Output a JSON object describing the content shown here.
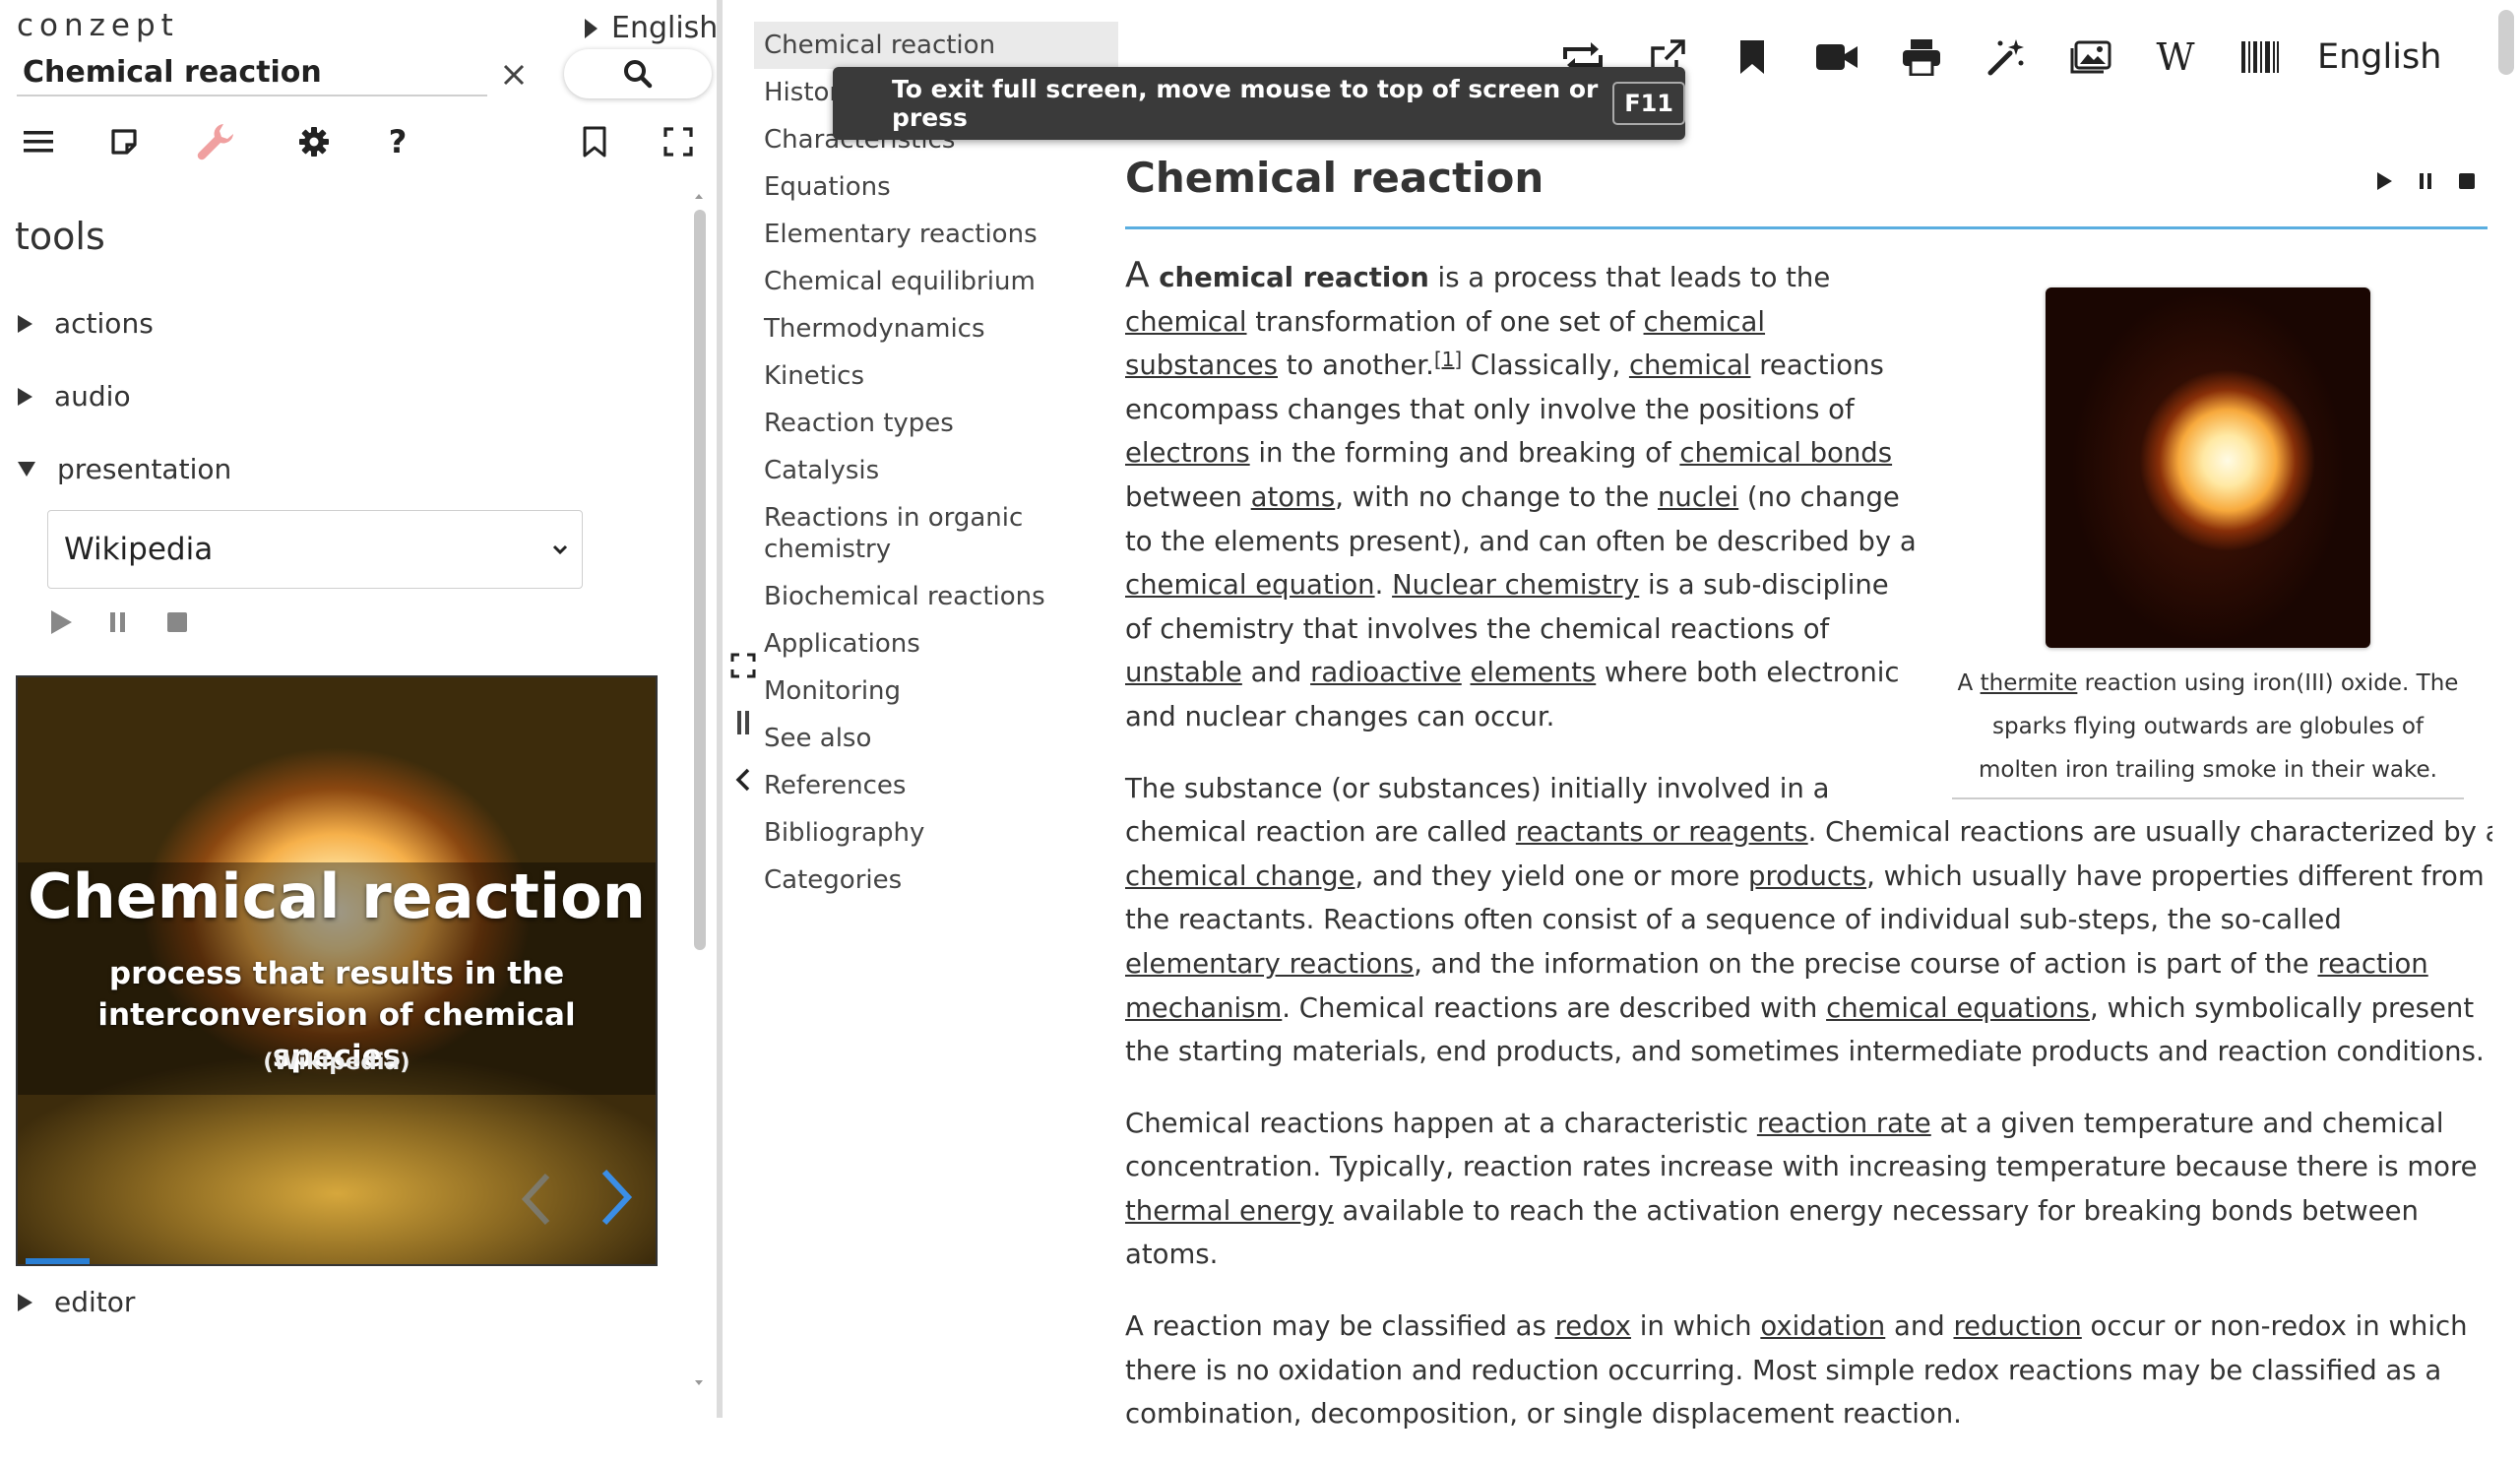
{
  "sidebar": {
    "brand": "conzept",
    "language": "English",
    "search": {
      "value": "Chemical reaction",
      "placeholder": ""
    },
    "tools_heading": "tools",
    "sections": {
      "actions": "actions",
      "audio": "audio",
      "presentation": "presentation",
      "editor": "editor"
    },
    "presentation_select": {
      "selected": "Wikipedia"
    },
    "slide": {
      "title": "Chemical reaction",
      "description": "process that results in the interconversion of chemical species",
      "source": "(Wikipedia)",
      "progress_fraction": 0.1
    }
  },
  "toc": {
    "items": [
      "Chemical reaction",
      "History",
      "Characteristics",
      "Equations",
      "Elementary reactions",
      "Chemical equilibrium",
      "Thermodynamics",
      "Kinetics",
      "Reaction types",
      "Catalysis",
      "Reactions in organic chemistry",
      "Biochemical reactions",
      "Applications",
      "Monitoring",
      "See also",
      "References",
      "Bibliography",
      "Categories"
    ]
  },
  "topbar": {
    "icons": [
      "swap-icon",
      "open-external-icon",
      "bookmark-icon",
      "video-icon",
      "print-icon",
      "magic-wand-icon",
      "images-icon",
      "wikipedia-icon",
      "barcode-icon"
    ],
    "language": "English"
  },
  "fullscreen_notice": {
    "text": "To exit full screen, move mouse to top of screen or press",
    "key": "F11"
  },
  "article": {
    "title": "Chemical reaction",
    "figure_caption_parts": [
      "A ",
      "thermite",
      " reaction using iron(III) oxide. The sparks flying outwards are globules of molten iron trailing smoke in their wake."
    ],
    "p1": [
      "A",
      " chemical reaction",
      " is a process that leads to the ",
      "chemical",
      " transformation of one set of ",
      "chemical substances",
      " to another.",
      "[1]",
      " Classically, ",
      "chemical",
      " reactions encompass changes that only involve the positions of ",
      "electrons",
      " in the forming and breaking of ",
      "chemical bonds",
      " between ",
      "atoms",
      ", with no change to the ",
      "nuclei",
      " (no change to the elements present), and can often be described by a ",
      "chemical equation",
      ". ",
      "Nuclear chemistry",
      " is a sub-discipline of chemistry that involves the chemical reactions of ",
      "unstable",
      " and ",
      "radioactive",
      " ",
      "elements",
      " where both electronic and nuclear changes can occur."
    ],
    "p2": [
      "The substance (or substances) initially involved in a chemical reaction are called ",
      "reactants or reagents",
      ". Chemical reactions are usually characterized by a ",
      "chemical change",
      ", and they yield one or more ",
      "products",
      ", which usually have properties different from the reactants. Reactions often consist of a sequence of individual sub-steps, the so-called ",
      "elementary reactions",
      ", and the information on the precise course of action is part of the ",
      "reaction mechanism",
      ". Chemical reactions are described with ",
      "chemical equations",
      ", which symbolically present the starting materials, end products, and sometimes intermediate products and reaction conditions."
    ],
    "p3": [
      "Chemical reactions happen at a characteristic ",
      "reaction rate",
      " at a given temperature and chemical concentration. Typically, reaction rates increase with increasing temperature because there is more ",
      "thermal energy",
      " available to reach the activation energy necessary for breaking bonds between atoms."
    ],
    "p4": [
      "A reaction may be classified as ",
      "redox",
      " in which ",
      "oxidation",
      " and ",
      "reduction",
      " occur or non-redox in which there is no oxidation and reduction occurring. Most simple redox reactions may be classified as a combination, decomposition, or single displacement reaction."
    ]
  },
  "colors": {
    "accent": "#5aaee0",
    "wrench": "#f0a0a0",
    "slide_progress": "#2a7fd4"
  }
}
